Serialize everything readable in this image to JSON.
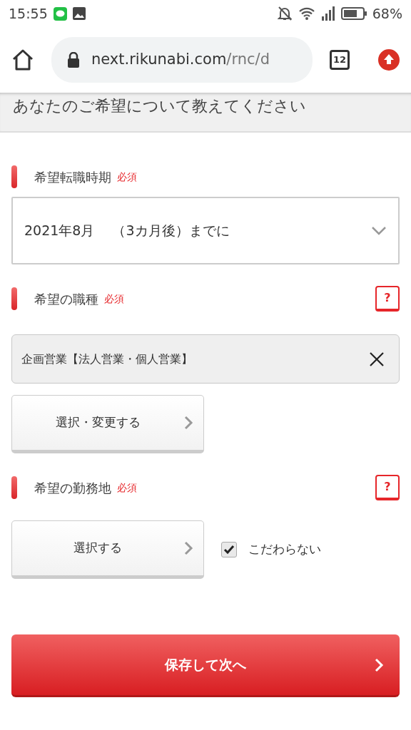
{
  "status_bar": {
    "time": "15:55",
    "battery": "68%"
  },
  "browser": {
    "url_host": "next.rikunabi.com",
    "url_path": "/rnc/d",
    "tab_count": "12"
  },
  "heading": "あなたのご希望について教えてください",
  "sections": [
    {
      "kind": "select",
      "label": "希望転職時期",
      "required_badge": "必須",
      "value": "2021年8月　 （3カ月後）までに"
    },
    {
      "kind": "chips",
      "label": "希望の職種",
      "required_badge": "必須",
      "help": "?",
      "selected_items": [
        {
          "label": "企画営業【法人営業・個人営業】"
        }
      ],
      "button": "選択・変更する"
    },
    {
      "kind": "location",
      "label": "希望の勤務地",
      "required_badge": "必須",
      "help": "?",
      "button": "選択する",
      "option": {
        "label": "こだわらない",
        "checked": true
      }
    }
  ],
  "submit": "保存して次へ"
}
